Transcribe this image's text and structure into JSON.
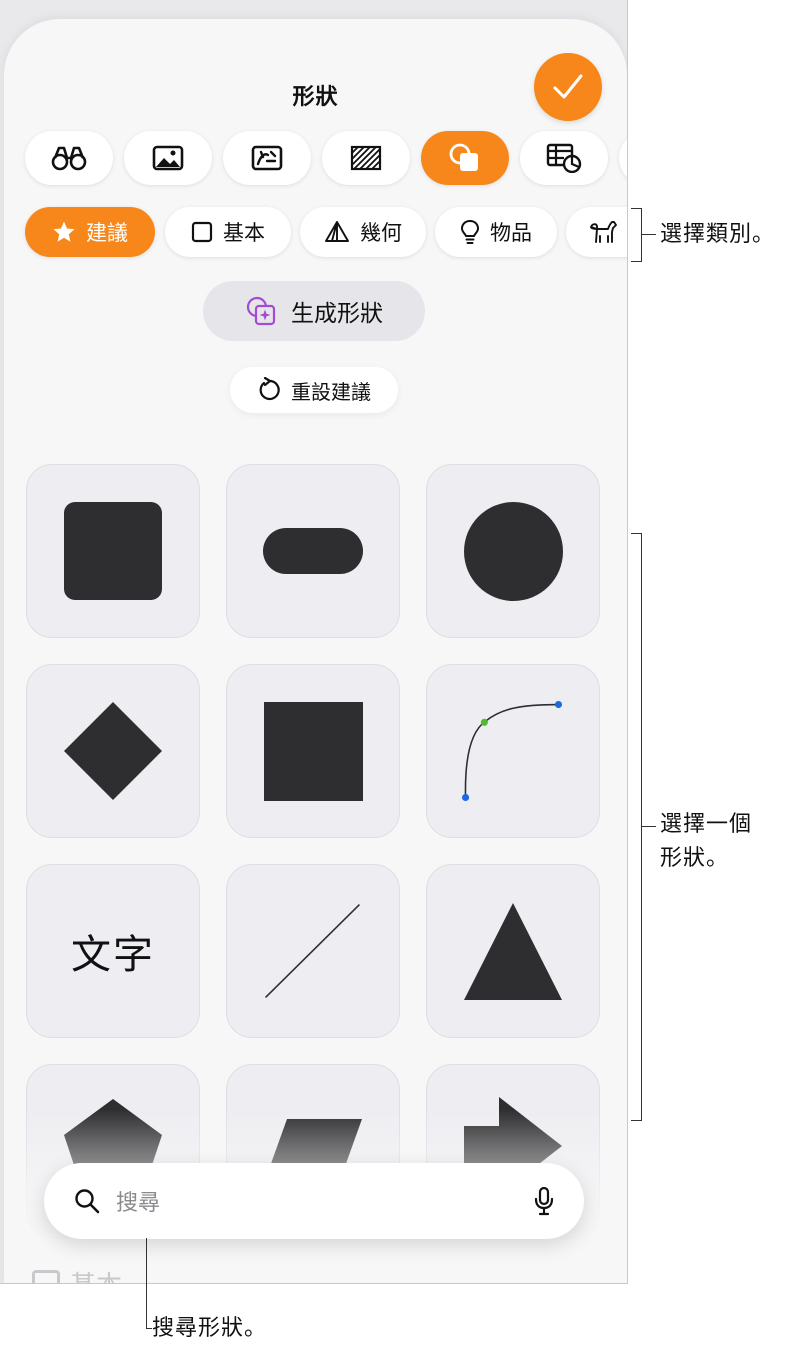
{
  "sheet": {
    "title": "形狀",
    "done_icon": "checkmark-icon",
    "accent_color": "#f7871a"
  },
  "tabs": [
    {
      "icon": "binoculars-icon",
      "active": false
    },
    {
      "icon": "image-icon",
      "active": false
    },
    {
      "icon": "photo-collage-icon",
      "active": false
    },
    {
      "icon": "hatched-square-icon",
      "active": false
    },
    {
      "icon": "shapes-icon",
      "active": true
    },
    {
      "icon": "table-chart-icon",
      "active": false
    }
  ],
  "categories": [
    {
      "label": "建議",
      "icon": "star-icon",
      "active": true
    },
    {
      "label": "基本",
      "icon": "square-outline-icon",
      "active": false
    },
    {
      "label": "幾何",
      "icon": "pyramid-icon",
      "active": false
    },
    {
      "label": "物品",
      "icon": "lightbulb-icon",
      "active": false
    },
    {
      "label": "",
      "icon": "dog-icon",
      "active": false
    }
  ],
  "generate_button": {
    "label": "生成形狀",
    "icon": "sparkle-shapes-icon"
  },
  "reset_button": {
    "label": "重設建議",
    "icon": "reset-arrow-icon"
  },
  "shapes": {
    "text_tile_label": "文字",
    "items": [
      "rounded-square",
      "pill",
      "circle",
      "diamond",
      "square",
      "curve",
      "text",
      "line",
      "triangle",
      "pentagon",
      "parallelogram",
      "arrow"
    ]
  },
  "ghost_label": "基本",
  "search": {
    "placeholder": "搜尋"
  },
  "callouts": {
    "category": "選擇類別。",
    "shape_line1": "選擇一個",
    "shape_line2": "形狀。",
    "search": "搜尋形狀。"
  }
}
